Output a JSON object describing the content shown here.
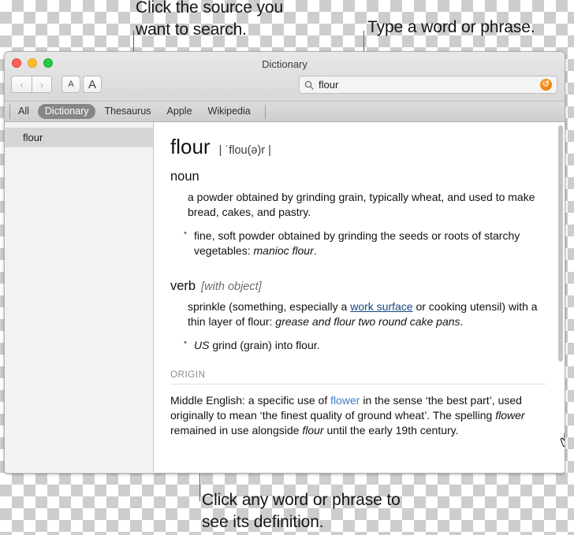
{
  "callouts": {
    "source": "Click the source you\nwant to search.",
    "type": "Type a word or phrase.",
    "click": "Click any word or phrase to\nsee its definition."
  },
  "window": {
    "title": "Dictionary",
    "traffic_lights": [
      "close-red",
      "minimize-yellow",
      "zoom-green"
    ],
    "toolbar": {
      "back_label": "‹",
      "forward_label": "›",
      "font_smaller_label": "A",
      "font_larger_label": "A",
      "search": {
        "icon": "search-icon",
        "value": "flour",
        "placeholder": "Search",
        "trailing_icon": "dictionary-app-icon"
      }
    },
    "sources": [
      {
        "label": "All",
        "active": false
      },
      {
        "label": "Dictionary",
        "active": true
      },
      {
        "label": "Thesaurus",
        "active": false
      },
      {
        "label": "Apple",
        "active": false
      },
      {
        "label": "Wikipedia",
        "active": false
      }
    ],
    "sidebar": {
      "items": [
        {
          "label": "flour",
          "selected": true
        }
      ]
    }
  },
  "entry": {
    "headword": "flour",
    "pronunciation": "| ˈflou(ə)r |",
    "noun": {
      "pos": "noun",
      "sense_1": "a powder obtained by grinding grain, typically wheat, and used to make bread, cakes, and pastry.",
      "sub_1_text": "fine, soft powder obtained by grinding the seeds or roots of starchy vegetables: ",
      "sub_1_example": "manioc flour",
      "sub_1_tail": "."
    },
    "verb": {
      "pos": "verb",
      "grammar": "[with object]",
      "sense_1_a": "sprinkle (something, especially a ",
      "sense_1_link": "work surface",
      "sense_1_b": " or cooking utensil) with a thin layer of flour: ",
      "sense_1_example": "grease and flour two round cake pans",
      "sense_1_tail": ".",
      "sub_1_label": "US",
      "sub_1_text": " grind (grain) into flour."
    },
    "origin": {
      "label": "ORIGIN",
      "text_a": "Middle English: a specific use of ",
      "link": "flower",
      "text_b": " in the sense ‘the best part’, used originally to mean ‘the finest quality of ground wheat’. The spelling ",
      "italic_1": "flower",
      "text_c": " remained in use alongside ",
      "italic_2": "flour",
      "text_d": " until the early 19th century."
    }
  },
  "colors": {
    "accent_orange": "#f08a12",
    "link_blue": "#3c7dc4",
    "inline_link": "#14457e",
    "active_tab_bg": "#868686",
    "sidebar_selected": "#d6d6d6"
  }
}
